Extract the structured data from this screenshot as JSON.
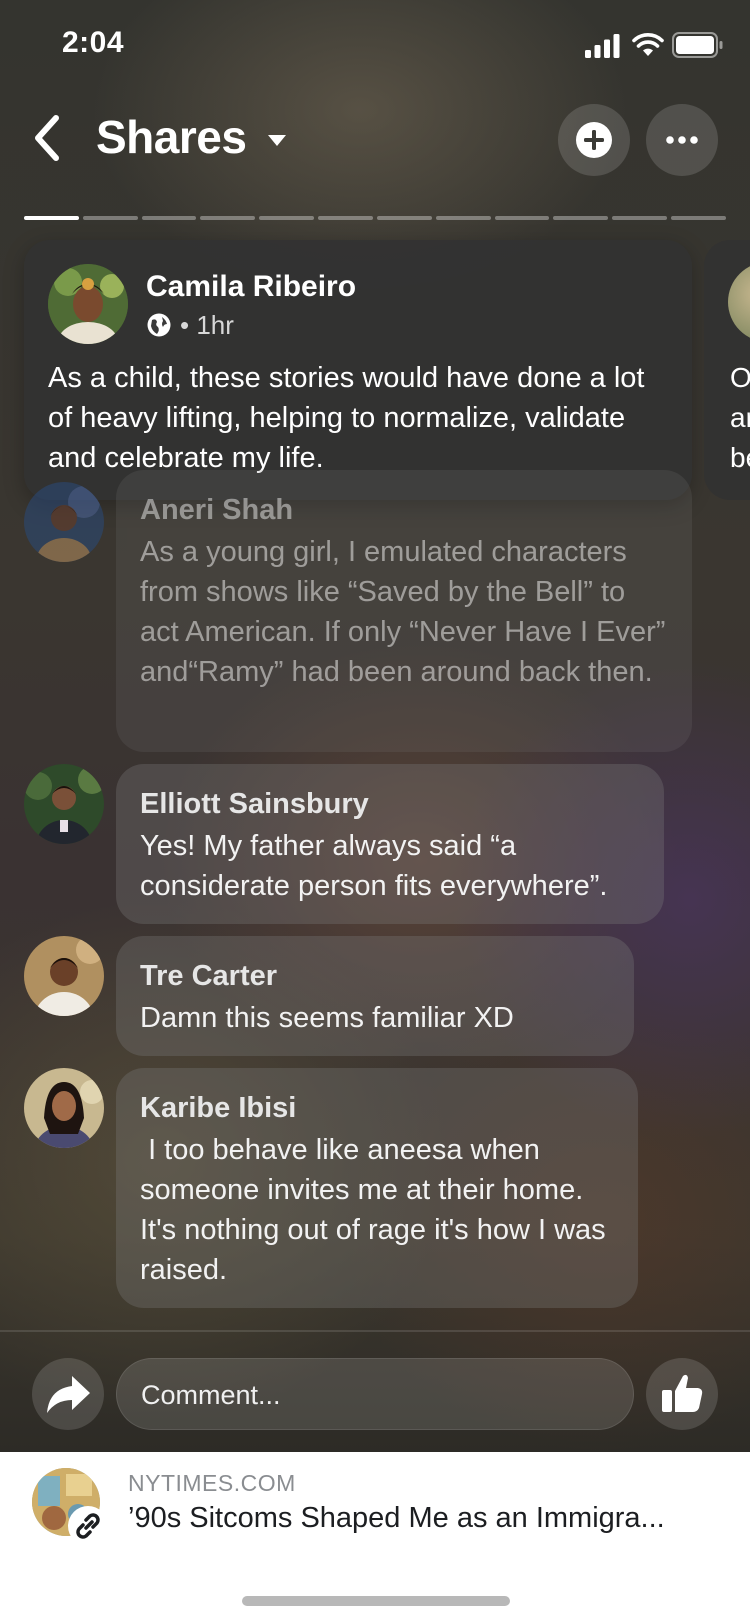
{
  "status_bar": {
    "time": "2:04"
  },
  "header": {
    "title": "Shares"
  },
  "story": {
    "segments": 12,
    "active_segment": 1,
    "author": "Camila Ribeiro",
    "time": "• 1hr",
    "text": "As a child, these stories would have done a lot of heavy lifting, helping to normalize, validate and celebrate my life.",
    "next_peek_lines": [
      "O",
      "ar",
      "be"
    ]
  },
  "comments": [
    {
      "name": "Aneri Shah",
      "text": "As a young girl, I emulated characters from shows like “Saved by the Bell” to act American. If only “Never Have I Ever” and“Ramy” had been around back then."
    },
    {
      "name": "Elliott Sainsbury",
      "text": "Yes! My father always said “a considerate person fits everywhere”."
    },
    {
      "name": "Tre Carter",
      "text": "Damn this seems familiar XD"
    },
    {
      "name": "Karibe Ibisi",
      "text": " I too behave like aneesa when someone invites me at their home. It's nothing out of rage it's how I was raised."
    }
  ],
  "comment_input": {
    "placeholder": "Comment..."
  },
  "link": {
    "source": "NYTIMES.COM",
    "title": "’90s Sitcoms Shaped Me as an Immigra..."
  }
}
